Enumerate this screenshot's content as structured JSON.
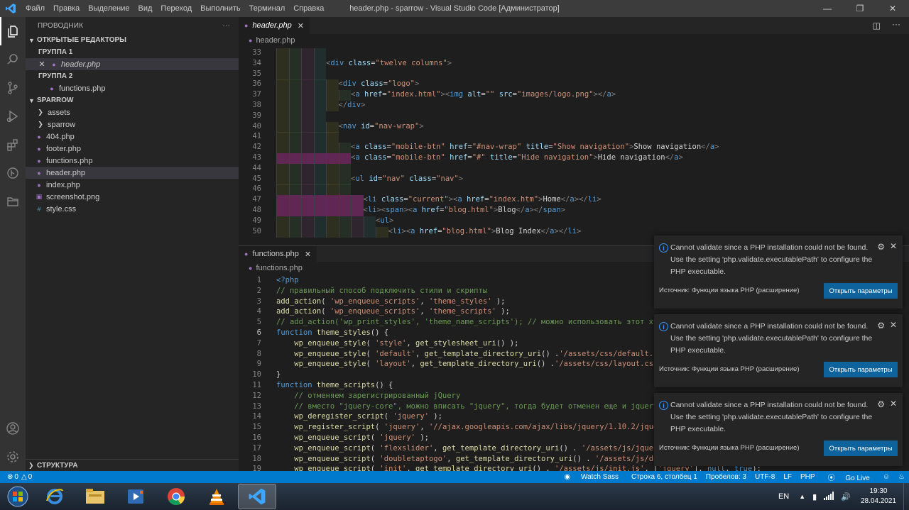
{
  "titlebar": {
    "menu": [
      "Файл",
      "Правка",
      "Выделение",
      "Вид",
      "Переход",
      "Выполнить",
      "Терминал",
      "Справка"
    ],
    "title": "header.php - sparrow - Visual Studio Code [Администратор]"
  },
  "sidebar": {
    "header": "ПРОВОДНИК",
    "more": "···",
    "open_editors": "ОТКРЫТЫЕ РЕДАКТОРЫ",
    "group1": "ГРУППА 1",
    "group1_file": "header.php",
    "group2": "ГРУППА 2",
    "group2_file": "functions.php",
    "project": "SPARROW",
    "folders": [
      "assets",
      "sparrow"
    ],
    "files": [
      {
        "name": "404.php",
        "icon": "php-icon"
      },
      {
        "name": "footer.php",
        "icon": "php-icon"
      },
      {
        "name": "functions.php",
        "icon": "php-icon"
      },
      {
        "name": "header.php",
        "icon": "php-icon"
      },
      {
        "name": "index.php",
        "icon": "php-icon"
      },
      {
        "name": "screenshot.png",
        "icon": "image-icon"
      },
      {
        "name": "style.css",
        "icon": "css-icon"
      }
    ],
    "outline": "СТРУКТУРА"
  },
  "editor1": {
    "tab": "header.php",
    "breadcrumb": "header.php",
    "line_numbers": [
      "33",
      "34",
      "35",
      "36",
      "37",
      "38",
      "39",
      "40",
      "41",
      "42",
      "43",
      "44",
      "45",
      "46",
      "47",
      "48",
      "49",
      "50"
    ],
    "lines": [
      "",
      "<div class=\"twelve columns\">",
      "",
      "<div class=\"logo\">",
      "<a href=\"index.html\"><img alt=\"\" src=\"images/logo.png\"></a>",
      "</div>",
      "",
      "<nav id=\"nav-wrap\">",
      "",
      "<a class=\"mobile-btn\" href=\"#nav-wrap\" title=\"Show navigation\">Show navigation</a>",
      "<a class=\"mobile-btn\" href=\"#\" title=\"Hide navigation\">Hide navigation</a>",
      "",
      "<ul id=\"nav\" class=\"nav\">",
      "",
      "<li class=\"current\"><a href=\"index.htm\">Home</a></li>",
      "<li><span><a href=\"blog.html\">Blog</a></span>",
      "<ul>",
      "<li><a href=\"blog.html\">Blog Index</a></li>"
    ]
  },
  "editor2": {
    "tab": "functions.php",
    "breadcrumb": "functions.php",
    "line_numbers": [
      "1",
      "2",
      "3",
      "4",
      "5",
      "6",
      "7",
      "8",
      "9",
      "10",
      "11",
      "12",
      "13",
      "14",
      "15",
      "16",
      "17",
      "18",
      "19"
    ],
    "lines": [
      "<?php",
      "// правильный способ подключить стили и скрипты",
      "add_action( 'wp_enqueue_scripts', 'theme_styles' );",
      "add_action( 'wp_enqueue_scripts', 'theme_scripts' );",
      "// add_action('wp_print_styles', 'theme_name_scripts'); // можно использовать этот хук он",
      "function theme_styles() {",
      "    wp_enqueue_style( 'style', get_stylesheet_uri() );",
      "    wp_enqueue_style( 'default', get_template_directory_uri() .'/assets/css/default.css');",
      "    wp_enqueue_style( 'layout', get_template_directory_uri() .'/assets/css/layout.css');",
      "}",
      "function theme_scripts() {",
      "    // отменяем зарегистрированный jQuery",
      "    // вместо \"jquery-core\", можно вписать \"jquery\", тогда будет отменен еще и jquery-migr",
      "    wp_deregister_script( 'jquery' );",
      "    wp_register_script( 'jquery', '//ajax.googleapis.com/ajax/libs/jquery/1.10.2/jquery.m",
      "    wp_enqueue_script( 'jquery' );",
      "    wp_enqueue_script( 'flexslider', get_template_directory_uri() . '/assets/js/jquery.fle",
      "    wp_enqueue_script( 'doubletaptogo', get_template_directory_uri() . '/assets/js/doublet",
      "    wp_enqueue_script( 'init', get_template_directory_uri() . '/assets/js/init.js', ['jquery'], null, true);"
    ]
  },
  "notification": {
    "message_line1": "Cannot validate since a PHP installation could not be found.",
    "message_line2": "Use the setting 'php.validate.executablePath' to configure the",
    "message_line3": "PHP executable.",
    "source": "Источник: Функции языка PHP (расширение)",
    "button": "Открыть параметры"
  },
  "statusbar": {
    "errors": "0",
    "warnings": "0",
    "watch_sass": "Watch Sass",
    "position": "Строка 6, столбец 1",
    "spaces": "Пробелов: 3",
    "encoding": "UTF-8",
    "eol": "LF",
    "language": "PHP",
    "go_live": "Go Live"
  },
  "taskbar": {
    "lang": "EN",
    "time": "19:30",
    "date": "28.04.2021"
  },
  "colors": {
    "accent": "#007acc",
    "notif_button": "#0e639c"
  }
}
